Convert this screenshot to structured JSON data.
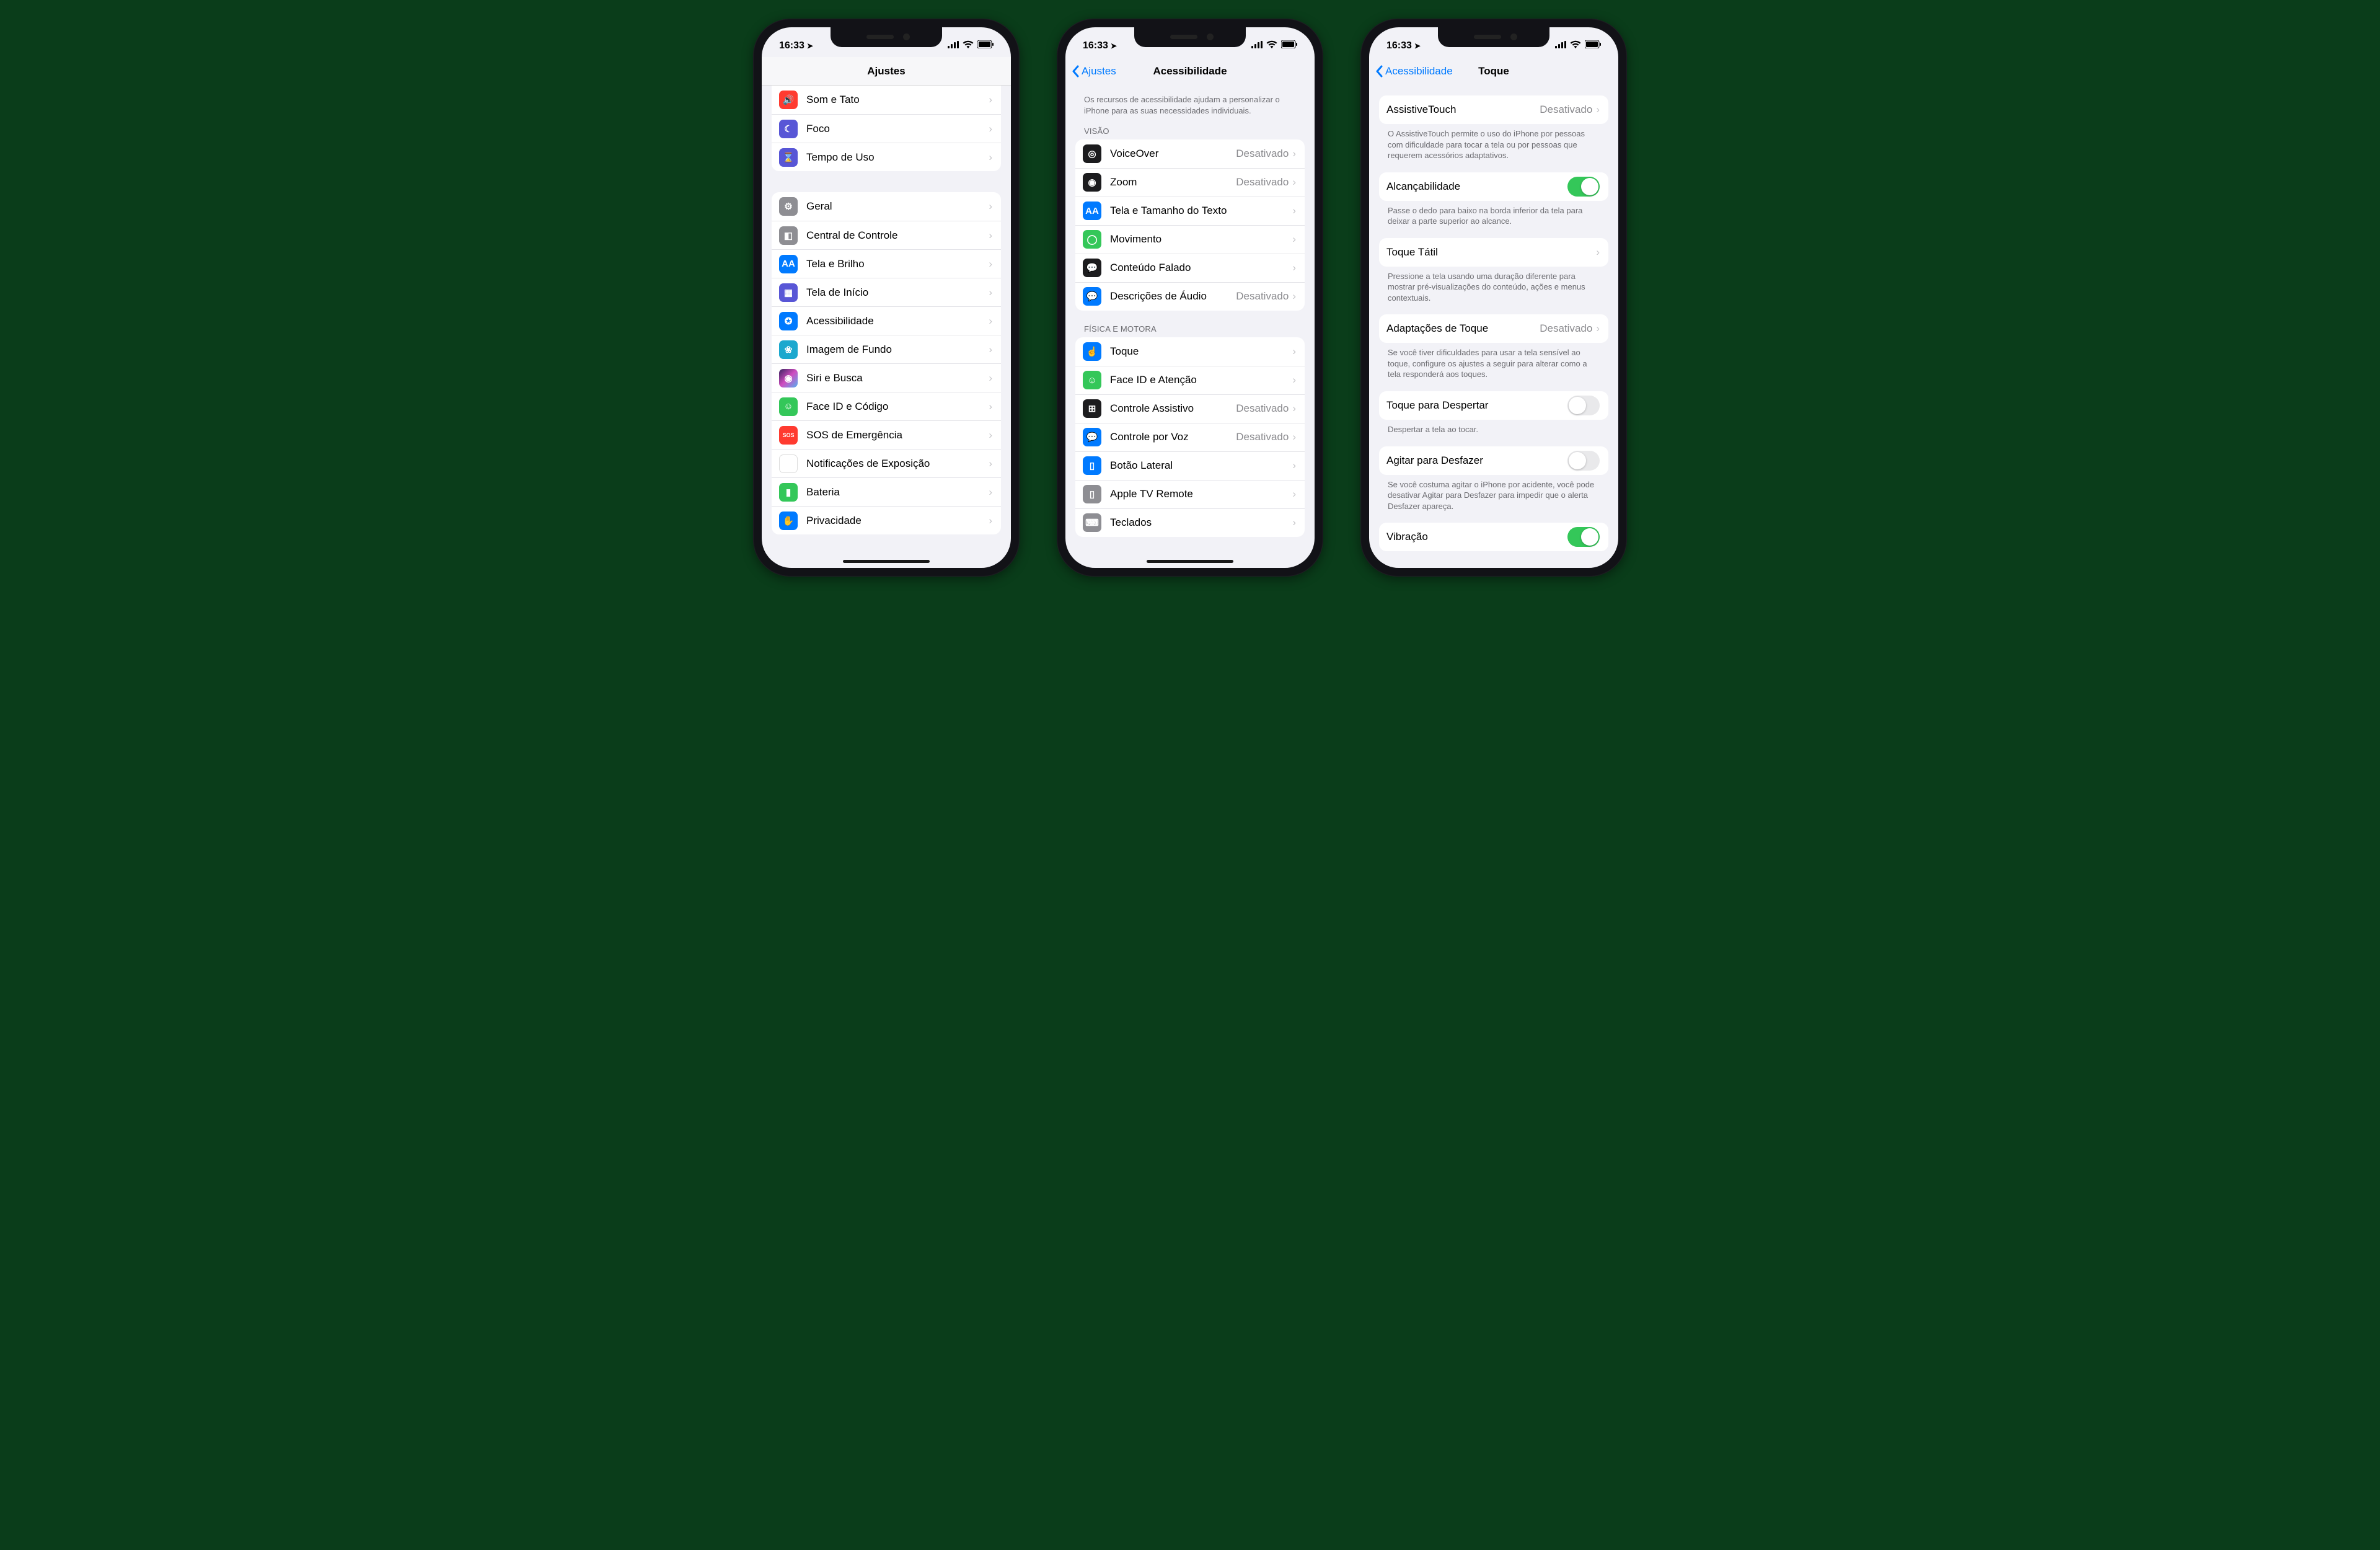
{
  "status": {
    "time": "16:33",
    "locationGlyph": "➤"
  },
  "phone1": {
    "title": "Ajustes",
    "group1": [
      {
        "label": "Som e Tato",
        "icon": "sound-icon",
        "color": "c-red",
        "glyph": "🔊"
      },
      {
        "label": "Foco",
        "icon": "focus-icon",
        "color": "c-purple",
        "glyph": "☾"
      },
      {
        "label": "Tempo de Uso",
        "icon": "screentime-icon",
        "color": "c-purple",
        "glyph": "⌛"
      }
    ],
    "group2": [
      {
        "label": "Geral",
        "icon": "general-icon",
        "color": "c-gray",
        "glyph": "⚙"
      },
      {
        "label": "Central de Controle",
        "icon": "controlcenter-icon",
        "color": "c-gray",
        "glyph": "◧"
      },
      {
        "label": "Tela e Brilho",
        "icon": "display-icon",
        "color": "c-blue",
        "glyph": "AA"
      },
      {
        "label": "Tela de Início",
        "icon": "homescreen-icon",
        "color": "c-purple",
        "glyph": "▦"
      },
      {
        "label": "Acessibilidade",
        "icon": "accessibility-icon",
        "color": "c-blue",
        "glyph": "✪"
      },
      {
        "label": "Imagem de Fundo",
        "icon": "wallpaper-icon",
        "color": "c-cyan",
        "glyph": "❀"
      },
      {
        "label": "Siri e Busca",
        "icon": "siri-icon",
        "color": "c-siri",
        "glyph": "◉"
      },
      {
        "label": "Face ID e Código",
        "icon": "faceid-icon",
        "color": "c-green",
        "glyph": "☺"
      },
      {
        "label": "SOS de Emergência",
        "icon": "sos-icon",
        "color": "c-red",
        "glyph": "SOS"
      },
      {
        "label": "Notificações de Exposição",
        "icon": "exposure-icon",
        "color": "c-white",
        "glyph": "❂"
      },
      {
        "label": "Bateria",
        "icon": "battery-icon",
        "color": "c-green",
        "glyph": "▮"
      },
      {
        "label": "Privacidade",
        "icon": "privacy-icon",
        "color": "c-blue",
        "glyph": "✋"
      }
    ]
  },
  "phone2": {
    "back": "Ajustes",
    "title": "Acessibilidade",
    "intro": "Os recursos de acessibilidade ajudam a personalizar o iPhone para as suas necessidades individuais.",
    "visionHeader": "VISÃO",
    "vision": [
      {
        "label": "VoiceOver",
        "value": "Desativado",
        "icon": "voiceover-icon",
        "color": "c-black",
        "glyph": "◎"
      },
      {
        "label": "Zoom",
        "value": "Desativado",
        "icon": "zoom-icon",
        "color": "c-black",
        "glyph": "◉"
      },
      {
        "label": "Tela e Tamanho do Texto",
        "value": "",
        "icon": "textsize-icon",
        "color": "c-blue",
        "glyph": "AA"
      },
      {
        "label": "Movimento",
        "value": "",
        "icon": "motion-icon",
        "color": "c-green",
        "glyph": "◯"
      },
      {
        "label": "Conteúdo Falado",
        "value": "",
        "icon": "spoken-icon",
        "color": "c-black",
        "glyph": "💬"
      },
      {
        "label": "Descrições de Áudio",
        "value": "Desativado",
        "icon": "audiodesc-icon",
        "color": "c-blue",
        "glyph": "💬"
      }
    ],
    "motorHeader": "FÍSICA E MOTORA",
    "motor": [
      {
        "label": "Toque",
        "value": "",
        "icon": "touch-icon",
        "color": "c-blue",
        "glyph": "☝"
      },
      {
        "label": "Face ID e Atenção",
        "value": "",
        "icon": "faceid2-icon",
        "color": "c-green",
        "glyph": "☺"
      },
      {
        "label": "Controle Assistivo",
        "value": "Desativado",
        "icon": "switchcontrol-icon",
        "color": "c-black",
        "glyph": "⊞"
      },
      {
        "label": "Controle por Voz",
        "value": "Desativado",
        "icon": "voicecontrol-icon",
        "color": "c-blue",
        "glyph": "💬"
      },
      {
        "label": "Botão Lateral",
        "value": "",
        "icon": "sidebutton-icon",
        "color": "c-blue",
        "glyph": "▯"
      },
      {
        "label": "Apple TV Remote",
        "value": "",
        "icon": "atvremote-icon",
        "color": "c-gray",
        "glyph": "▯"
      },
      {
        "label": "Teclados",
        "value": "",
        "icon": "keyboards-icon",
        "color": "c-gray",
        "glyph": "⌨"
      }
    ]
  },
  "phone3": {
    "back": "Acessibilidade",
    "title": "Toque",
    "rows": {
      "assistive": {
        "label": "AssistiveTouch",
        "value": "Desativado"
      },
      "assistiveFooter": "O AssistiveTouch permite o uso do iPhone por pessoas com dificuldade para tocar a tela ou por pessoas que requerem acessórios adaptativos.",
      "reach": {
        "label": "Alcançabilidade",
        "on": true
      },
      "reachFooter": "Passe o dedo para baixo na borda inferior da tela para deixar a parte superior ao alcance.",
      "haptic": {
        "label": "Toque Tátil"
      },
      "hapticFooter": "Pressione a tela usando uma duração diferente para mostrar pré-visualizações do conteúdo, ações e menus contextuais.",
      "accom": {
        "label": "Adaptações de Toque",
        "value": "Desativado"
      },
      "accomFooter": "Se você tiver dificuldades para usar a tela sensível ao toque, configure os ajustes a seguir para alterar como a tela responderá aos toques.",
      "tapWake": {
        "label": "Toque para Despertar",
        "on": false
      },
      "tapWakeFooter": "Despertar a tela ao tocar.",
      "shake": {
        "label": "Agitar para Desfazer",
        "on": false
      },
      "shakeFooter": "Se você costuma agitar o iPhone por acidente, você pode desativar Agitar para Desfazer para impedir que o alerta Desfazer apareça.",
      "vibration": {
        "label": "Vibração",
        "on": true
      }
    }
  }
}
